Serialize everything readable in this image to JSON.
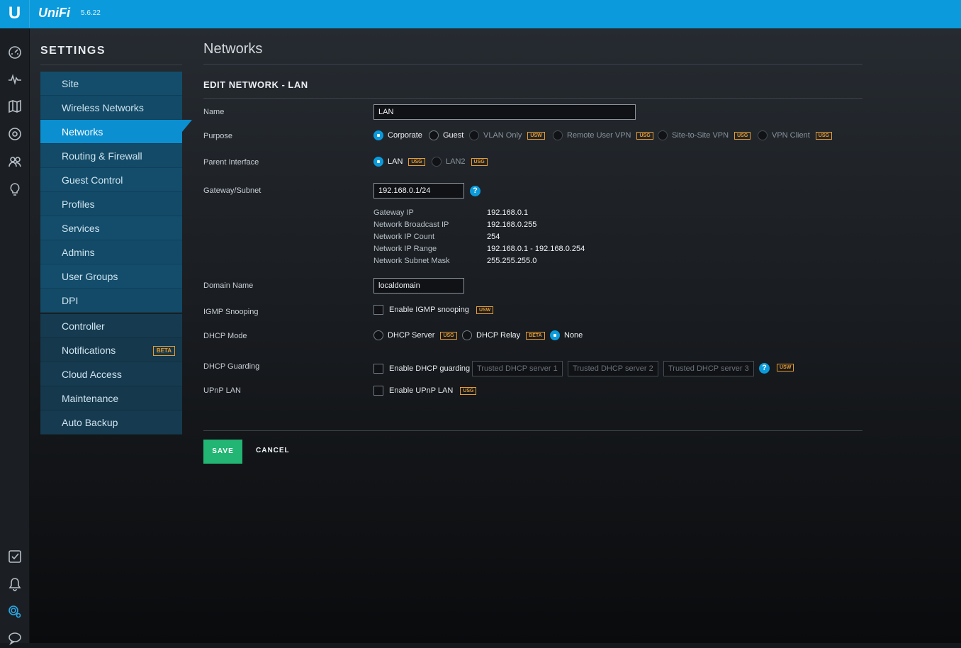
{
  "app": {
    "logo": "U",
    "brand": "UniFi",
    "version": "5.6.22"
  },
  "rail": {
    "icons": [
      "dashboard-icon",
      "statistics-icon",
      "map-icon",
      "devices-icon",
      "clients-icon",
      "insights-icon",
      "alerts-check-icon",
      "notifications-bell-icon",
      "settings-gear-icon",
      "chat-icon"
    ]
  },
  "sidebar": {
    "title": "SETTINGS",
    "items": [
      "Site",
      "Wireless Networks",
      "Networks",
      "Routing & Firewall",
      "Guest Control",
      "Profiles",
      "Services",
      "Admins",
      "User Groups",
      "DPI"
    ],
    "controller_items": [
      "Controller",
      "Notifications",
      "Cloud Access",
      "Maintenance",
      "Auto Backup"
    ],
    "notifications_badge": "BETA",
    "active": "Networks"
  },
  "page": {
    "title": "Networks",
    "section": "EDIT NETWORK - LAN"
  },
  "form": {
    "name_label": "Name",
    "name_value": "LAN",
    "purpose_label": "Purpose",
    "purpose_options": {
      "corporate": "Corporate",
      "guest": "Guest",
      "vlan_only": "VLAN Only",
      "remote_vpn": "Remote User VPN",
      "s2s_vpn": "Site-to-Site VPN",
      "vpn_client": "VPN Client"
    },
    "tag_usw": "USW",
    "tag_usg": "USG",
    "tag_beta": "BETA",
    "parent_label": "Parent Interface",
    "parent_lan": "LAN",
    "parent_lan2": "LAN2",
    "gateway_label": "Gateway/Subnet",
    "gateway_value": "192.168.0.1/24",
    "info": {
      "gateway_ip_k": "Gateway IP",
      "gateway_ip_v": "192.168.0.1",
      "broadcast_k": "Network Broadcast IP",
      "broadcast_v": "192.168.0.255",
      "count_k": "Network IP Count",
      "count_v": "254",
      "range_k": "Network IP Range",
      "range_v": "192.168.0.1 - 192.168.0.254",
      "mask_k": "Network Subnet Mask",
      "mask_v": "255.255.255.0"
    },
    "domain_label": "Domain Name",
    "domain_value": "localdomain",
    "igmp_label": "IGMP Snooping",
    "igmp_check": "Enable IGMP snooping",
    "dhcp_mode_label": "DHCP Mode",
    "dhcp_server": "DHCP Server",
    "dhcp_relay": "DHCP Relay",
    "dhcp_none": "None",
    "guard_label": "DHCP Guarding",
    "guard_check": "Enable DHCP guarding",
    "guard_placeholders": [
      "Trusted DHCP server 1",
      "Trusted DHCP server 2",
      "Trusted DHCP server 3"
    ],
    "upnp_label": "UPnP LAN",
    "upnp_check": "Enable UPnP LAN",
    "help": "?"
  },
  "actions": {
    "save": "SAVE",
    "cancel": "CANCEL"
  },
  "colors": {
    "accent": "#0b9bdc",
    "save": "#22b573",
    "tag": "#e79b2e"
  }
}
